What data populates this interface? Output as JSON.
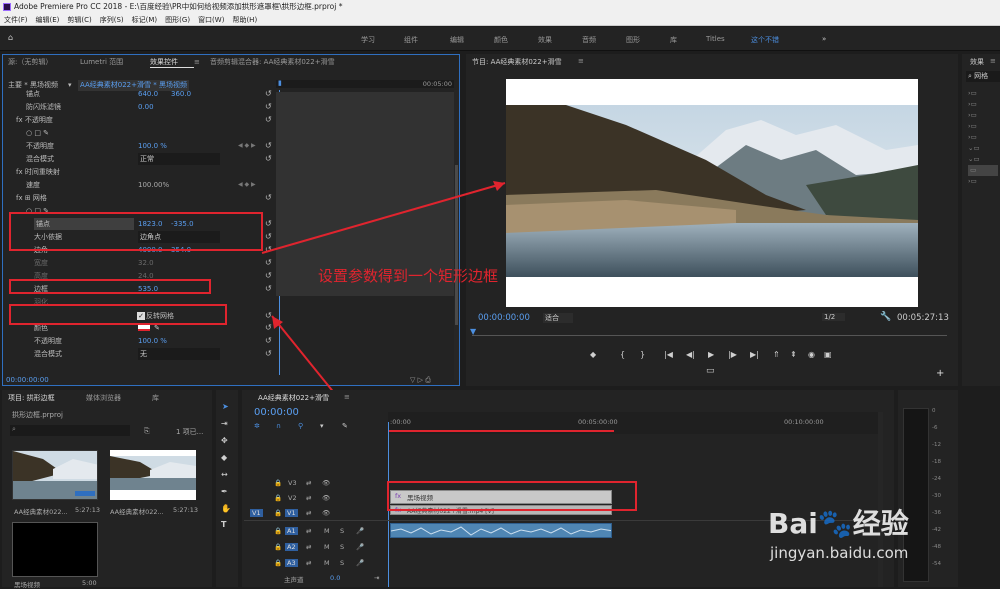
{
  "app": {
    "title": "Adobe Premiere Pro CC 2018 - E:\\百度经验\\PR中如何给视频添加拱形遮罩框\\拱形边框.prproj *"
  },
  "menu": [
    "文件(F)",
    "编辑(E)",
    "剪辑(C)",
    "序列(S)",
    "标记(M)",
    "图形(G)",
    "窗口(W)",
    "帮助(H)"
  ],
  "workspaces": [
    "学习",
    "组件",
    "编辑",
    "颜色",
    "效果",
    "音频",
    "图形",
    "库",
    "Titles",
    "这个不错",
    "»"
  ],
  "effects_panel": {
    "tabs": [
      "源:（无剪辑）",
      "Lumetri 范围",
      "效果控件",
      "≡",
      "音频剪辑混合器: AA经典素材022+滑雪"
    ],
    "clip_header": {
      "master": "主要 * 黑场视频",
      "arrow": "▾",
      "clip": "AA经典素材022+滑雪 * 黑场视频",
      "ruler": "00:05:00"
    },
    "rows": [
      {
        "label": "锚点",
        "v1": "640.0",
        "v2": "360.0"
      },
      {
        "label": "防闪烁滤镜",
        "v1": "0.00"
      },
      {
        "label": "fx  不透明度"
      },
      {
        "label": "○ □ ✎"
      },
      {
        "label": "不透明度",
        "v1": "100.0 %"
      },
      {
        "label": "混合模式",
        "v1": "正常"
      },
      {
        "label": "fx  时间重映射"
      },
      {
        "label": "速度",
        "v1": "100.00%"
      },
      {
        "label": "fx  ⊞ 网格"
      },
      {
        "label": "○ □ ✎"
      },
      {
        "label": "锚点",
        "v1": "1823.0",
        "v2": "-335.0"
      },
      {
        "label": "大小依据",
        "v1": "边角点"
      },
      {
        "label": "边角",
        "v1": "4000.0",
        "v2": "354.0"
      },
      {
        "label": "宽度",
        "v1": "32.0"
      },
      {
        "label": "高度",
        "v1": "24.0"
      },
      {
        "label": "边框",
        "v1": "535.0"
      },
      {
        "label": "羽化"
      },
      {
        "label": "反转网格"
      },
      {
        "label": "颜色"
      },
      {
        "label": "不透明度",
        "v1": "100.0 %"
      },
      {
        "label": "混合模式",
        "v1": "无"
      }
    ],
    "time": "00:00:00:00"
  },
  "program": {
    "title": "节目: AA经典素材022+滑雪",
    "menu": "≡",
    "time": "00:00:00:00",
    "fit": "适合",
    "res": "1/2",
    "duration": "00:05:27:13"
  },
  "annotation": "设置参数得到一个矩形边框",
  "project": {
    "tabs": [
      "项目: 拱形边框",
      "媒体浏览器",
      "库"
    ],
    "file": "拱形边框.prproj",
    "count": "1 项已...",
    "items": [
      {
        "name": "AA经典素材022...",
        "dur": "5:27:13"
      },
      {
        "name": "AA经典素材022...",
        "dur": "5:27:13"
      },
      {
        "name": "黑场视频",
        "dur": "5:00"
      }
    ]
  },
  "timeline": {
    "tab": "AA经典素材022+滑雪",
    "tabmenu": "≡",
    "time": "00:00:00",
    "ruler": [
      ":00:00",
      "00:05:00:00",
      "00:10:00:00"
    ],
    "tracks": [
      "V3",
      "V2",
      "V1",
      "A1",
      "A2",
      "A3"
    ],
    "master": "主声道",
    "master_val": "0.0",
    "clip_v2": "黑场视频",
    "clip_v1": "AA经典素材022+滑雪.mp4 [V]",
    "src": "V1"
  },
  "right_panel": {
    "title": "效果",
    "menu": "≡",
    "search": "网格"
  },
  "meters": [
    "0",
    "-6",
    "-12",
    "-18",
    "-24",
    "-30",
    "-36",
    "-42",
    "-48",
    "-54"
  ],
  "watermark": {
    "logo": "Bai🐾经验",
    "url": "jingyan.baidu.com"
  }
}
